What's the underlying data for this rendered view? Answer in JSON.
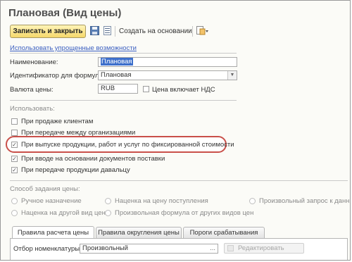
{
  "window": {
    "title": "Плановая (Вид цены)"
  },
  "toolbar": {
    "save_close_label": "Записать и закрыть",
    "create_based_label": "Создать на основании",
    "save_icon": "floppy-disk-icon",
    "list_icon": "list-icon",
    "add_icon": "add-document-icon"
  },
  "link_simplified": "Использовать упрощенные возможности",
  "fields": {
    "name": {
      "label": "Наименование:",
      "value": "Плановая"
    },
    "formula_id": {
      "label": "Идентификатор для формул:",
      "value": "Плановая"
    },
    "currency": {
      "label": "Валюта цены:",
      "value": "RUB"
    },
    "vat_checkbox": {
      "label": "Цена включает НДС",
      "checked": false
    }
  },
  "usage": {
    "heading": "Использовать:",
    "items": [
      {
        "label": "При продаже клиентам",
        "checked": false
      },
      {
        "label": "При передаче между организациями",
        "checked": false
      },
      {
        "label": "При выпуске продукции, работ и услуг по фиксированной стоимости",
        "checked": true,
        "highlighted": true
      },
      {
        "label": "При вводе на основании документов поставки",
        "checked": true
      },
      {
        "label": "При передаче продукции давальцу",
        "checked": true
      }
    ]
  },
  "price_method": {
    "heading": "Способ задания цены:",
    "options": [
      {
        "label": "Ручное назначение",
        "selected": true
      },
      {
        "label": "Наценка на цену поступления",
        "selected": false
      },
      {
        "label": "Произвольный запрос к данны",
        "selected": false
      },
      {
        "label": "Наценка на другой вид цен",
        "selected": false
      },
      {
        "label": "Произвольная формула от других видов цен",
        "selected": false
      }
    ]
  },
  "tabs": [
    {
      "label": "Правила расчета цены",
      "active": true
    },
    {
      "label": "Правила округления цены",
      "active": false
    },
    {
      "label": "Пороги срабатывания",
      "active": false
    }
  ],
  "filter": {
    "label": "Отбор номенклатуры:",
    "value": "Произвольный",
    "ellipsis": "...",
    "edit_button": "Редактировать"
  },
  "colors": {
    "highlight_oval": "#c9504a",
    "primary_button": "#f5d86b",
    "link": "#3b5fc0",
    "selection": "#3d6fcb"
  }
}
